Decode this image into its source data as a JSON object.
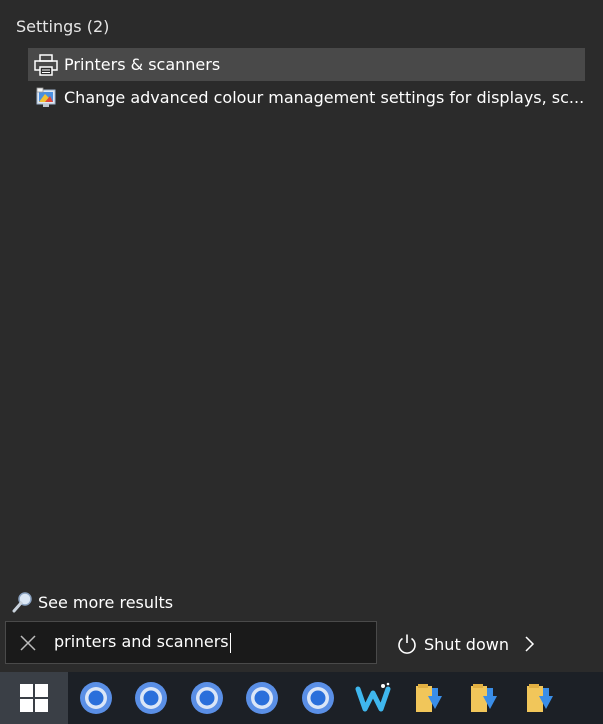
{
  "start_menu": {
    "section_header": "Settings (2)",
    "results": [
      {
        "label": "Printers & scanners",
        "icon": "printer-icon",
        "selected": true
      },
      {
        "label": "Change advanced colour management settings for displays, sc...",
        "icon": "colour-management-icon",
        "selected": false
      }
    ],
    "see_more": "See more results",
    "search": {
      "value": "printers and scanners"
    },
    "shutdown_label": "Shut down"
  },
  "taskbar": {
    "apps": [
      "chrome-icon",
      "chrome-icon",
      "chrome-icon",
      "chrome-icon",
      "chrome-icon",
      "w-app-icon",
      "download-folder-icon",
      "download-folder-icon",
      "download-folder-icon"
    ]
  },
  "colors": {
    "panel_bg": "#2b2b2b",
    "selected_bg": "#494949",
    "taskbar_bg": "#1c2026",
    "accent": "#2f7de1"
  }
}
